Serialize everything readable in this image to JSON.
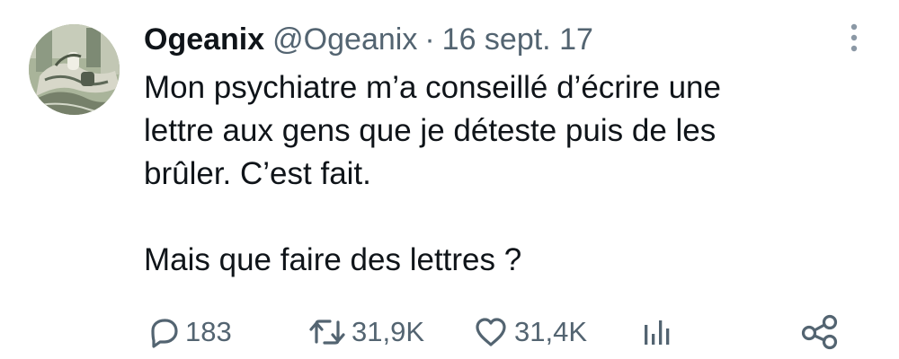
{
  "author": {
    "display_name": "Ogeanix",
    "handle": "@Ogeanix",
    "separator": "·",
    "date": "16 sept. 17"
  },
  "tweet": {
    "lines": [
      "Mon psychiatre m’a conseillé d’écrire une",
      "lettre aux gens que je déteste puis de les",
      "brûler. C’est fait.",
      "Mais que faire des lettres ?"
    ]
  },
  "actions": {
    "replies": "183",
    "retweets": "31,9K",
    "likes": "31,4K"
  },
  "icons": {
    "more": "more-vertical-icon",
    "reply": "speech-bubble-icon",
    "retweet": "retweet-arrows-icon",
    "like": "heart-icon",
    "views": "bar-chart-icon",
    "share": "share-nodes-icon"
  },
  "colors": {
    "text": "#0f1419",
    "secondary": "#536471",
    "background": "#ffffff"
  }
}
